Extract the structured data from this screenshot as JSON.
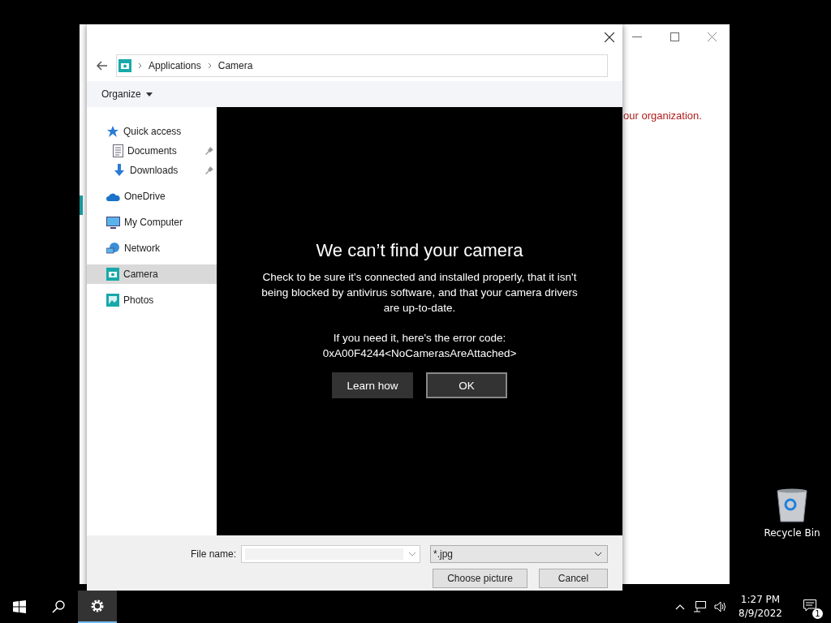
{
  "back_window": {
    "message": "our organization."
  },
  "dialog": {
    "breadcrumb": [
      "Applications",
      "Camera"
    ],
    "toolbar": {
      "organize": "Organize"
    },
    "nav": [
      {
        "label": "Quick access",
        "selected": false,
        "children": [
          {
            "label": "Documents",
            "selected": false,
            "pinned": true
          },
          {
            "label": "Downloads",
            "selected": false,
            "pinned": true
          }
        ]
      },
      {
        "label": "OneDrive",
        "selected": false
      },
      {
        "label": "My Computer",
        "selected": false
      },
      {
        "label": "Network",
        "selected": false
      },
      {
        "label": "Camera",
        "selected": true
      },
      {
        "label": "Photos",
        "selected": false
      }
    ],
    "error": {
      "title": "We can’t find your camera",
      "message": "Check to be sure it's connected and installed properly, that it isn't being blocked by antivirus software, and that your camera drivers are up-to-date.",
      "code_label": "If you need it, here's the error code:",
      "code": "0xA00F4244<NoCamerasAreAttached>",
      "buttons": [
        {
          "label": "Learn how",
          "selected": false
        },
        {
          "label": "OK",
          "selected": true
        }
      ]
    },
    "footer": {
      "file_name_label": "File name:",
      "file_type": "*.jpg",
      "buttons": [
        "Choose picture",
        "Cancel"
      ]
    }
  },
  "desktop": {
    "icons": [
      {
        "label": "Recycle Bin"
      }
    ]
  },
  "taskbar": {
    "apps": [
      {
        "kind": "start",
        "selected": false
      },
      {
        "kind": "search",
        "selected": false
      },
      {
        "kind": "settings",
        "selected": true
      }
    ],
    "time": "1:27 PM",
    "date": "8/9/2022",
    "notifications": "1"
  }
}
